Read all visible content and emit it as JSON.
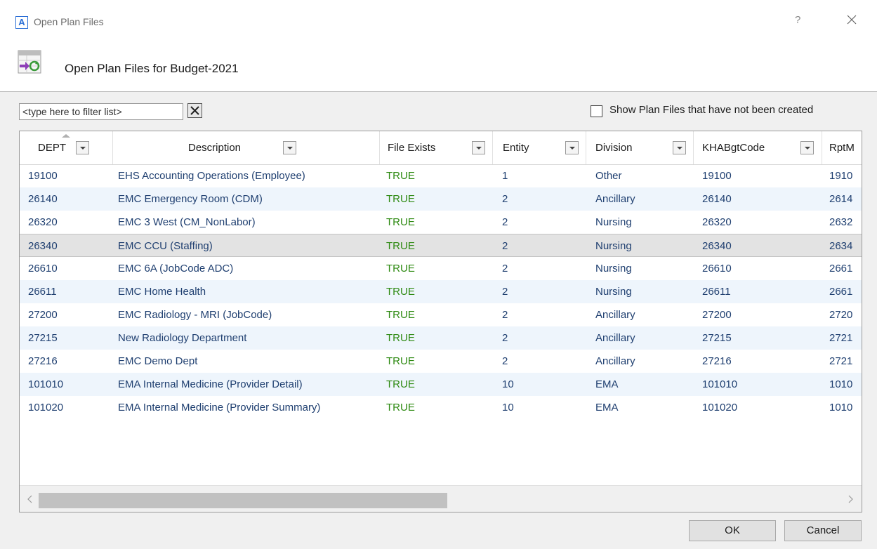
{
  "window": {
    "title": "Open Plan Files",
    "help_label": "?",
    "app_icon_letter": "A"
  },
  "header": {
    "title": "Open Plan Files for Budget-2021"
  },
  "filter": {
    "placeholder": "<type here to filter list>",
    "value": ""
  },
  "show_uncreated": {
    "label": "Show Plan Files that have not been created",
    "checked": false
  },
  "grid": {
    "columns": [
      "DEPT",
      "Description",
      "File Exists",
      "Entity",
      "Division",
      "KHABgtCode",
      "RptM"
    ],
    "rows": [
      {
        "dept": "19100",
        "desc": "EHS Accounting Operations (Employee)",
        "exists": "TRUE",
        "entity": "1",
        "division": "Other",
        "kha": "19100",
        "rpt": "1910"
      },
      {
        "dept": "26140",
        "desc": "EMC Emergency Room (CDM)",
        "exists": "TRUE",
        "entity": "2",
        "division": "Ancillary",
        "kha": "26140",
        "rpt": "2614"
      },
      {
        "dept": "26320",
        "desc": "EMC 3 West (CM_NonLabor)",
        "exists": "TRUE",
        "entity": "2",
        "division": "Nursing",
        "kha": "26320",
        "rpt": "2632"
      },
      {
        "dept": "26340",
        "desc": "EMC CCU (Staffing)",
        "exists": "TRUE",
        "entity": "2",
        "division": "Nursing",
        "kha": "26340",
        "rpt": "2634"
      },
      {
        "dept": "26610",
        "desc": "EMC 6A (JobCode ADC)",
        "exists": "TRUE",
        "entity": "2",
        "division": "Nursing",
        "kha": "26610",
        "rpt": "2661"
      },
      {
        "dept": "26611",
        "desc": "EMC Home Health",
        "exists": "TRUE",
        "entity": "2",
        "division": "Nursing",
        "kha": "26611",
        "rpt": "2661"
      },
      {
        "dept": "27200",
        "desc": "EMC Radiology - MRI (JobCode)",
        "exists": "TRUE",
        "entity": "2",
        "division": "Ancillary",
        "kha": "27200",
        "rpt": "2720"
      },
      {
        "dept": "27215",
        "desc": "New Radiology Department",
        "exists": "TRUE",
        "entity": "2",
        "division": "Ancillary",
        "kha": "27215",
        "rpt": "2721"
      },
      {
        "dept": "27216",
        "desc": "EMC Demo Dept",
        "exists": "TRUE",
        "entity": "2",
        "division": "Ancillary",
        "kha": "27216",
        "rpt": "2721"
      },
      {
        "dept": "101010",
        "desc": "EMA Internal Medicine (Provider Detail)",
        "exists": "TRUE",
        "entity": "10",
        "division": "EMA",
        "kha": "101010",
        "rpt": "1010"
      },
      {
        "dept": "101020",
        "desc": "EMA Internal Medicine (Provider Summary)",
        "exists": "TRUE",
        "entity": "10",
        "division": "EMA",
        "kha": "101020",
        "rpt": "1010"
      }
    ]
  },
  "buttons": {
    "ok": "OK",
    "cancel": "Cancel"
  },
  "colors": {
    "accent": "#2b6fd6",
    "true_value": "#2e8a12",
    "row_text": "#1f3f70",
    "alt_row": "#eef5fc"
  }
}
